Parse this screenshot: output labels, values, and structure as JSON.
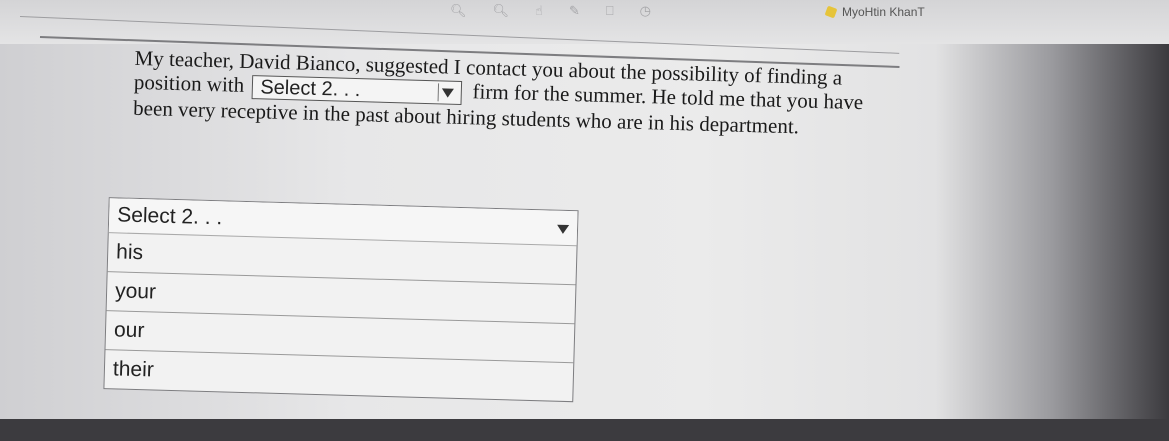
{
  "header": {
    "user_name": "MyoHtin KhanT"
  },
  "passage": {
    "part1": "My teacher, David Bianco, suggested I contact you about the possibility of finding a position with",
    "part2": "firm for the summer. He told me that you have been very receptive in the past about hiring students who are in his department."
  },
  "inline_select": {
    "value": "Select 2. . ."
  },
  "dropdown": {
    "selected": "Select 2. . .",
    "options": [
      "his",
      "your",
      "our",
      "their"
    ]
  }
}
